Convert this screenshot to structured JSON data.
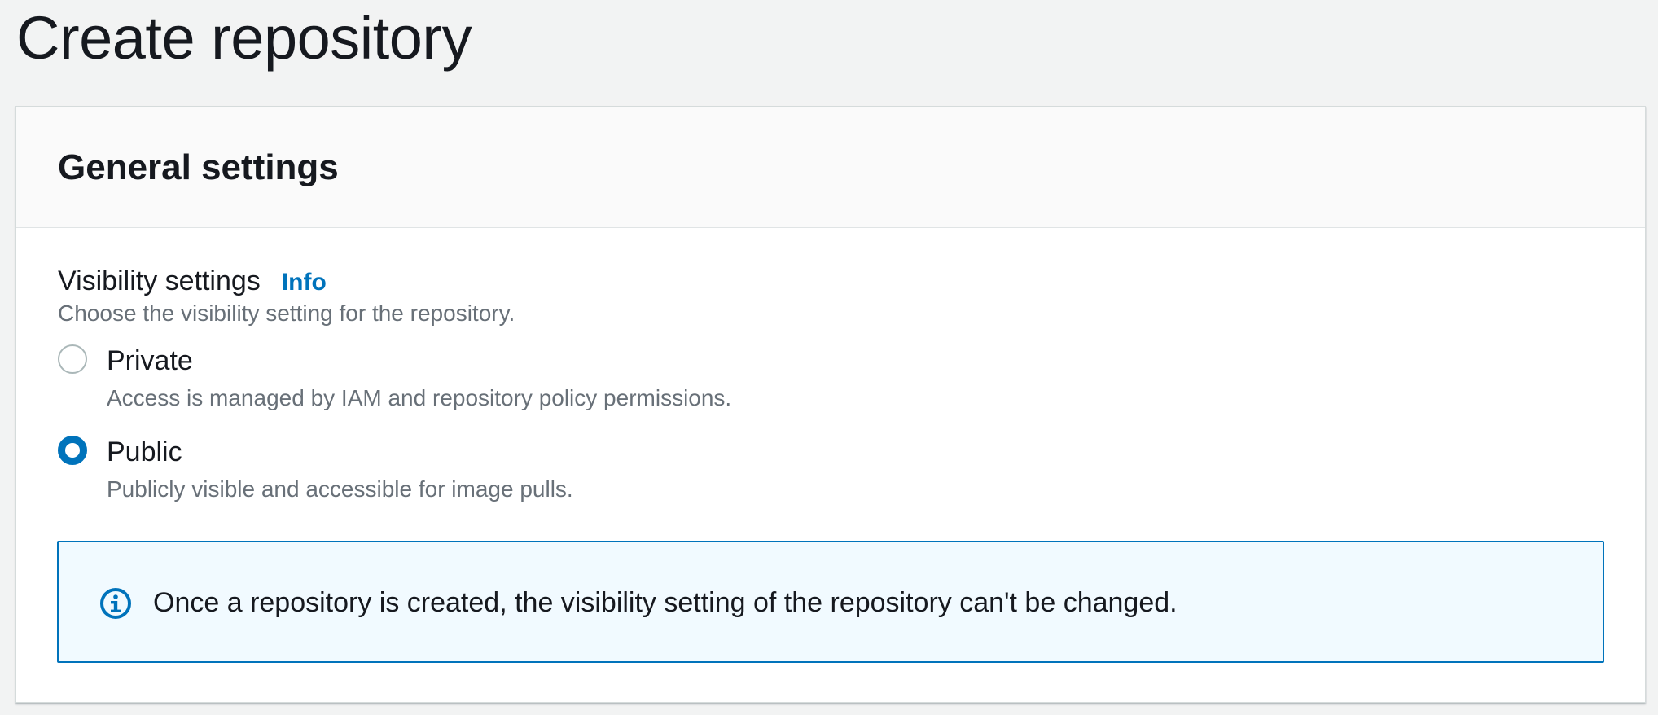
{
  "page": {
    "title": "Create repository"
  },
  "general_settings": {
    "title": "General settings",
    "visibility": {
      "label": "Visibility settings",
      "info_link": "Info",
      "description": "Choose the visibility setting for the repository.",
      "options": [
        {
          "label": "Private",
          "description": "Access is managed by IAM and repository policy permissions.",
          "selected": false
        },
        {
          "label": "Public",
          "description": "Publicly visible and accessible for image pulls.",
          "selected": true
        }
      ]
    },
    "alert": {
      "icon": "info-circle-icon",
      "message": "Once a repository is created, the visibility setting of the repository can't be changed."
    }
  },
  "colors": {
    "accent": "#0073bb",
    "alert_background": "#f1faff",
    "page_background": "#f2f3f3"
  }
}
